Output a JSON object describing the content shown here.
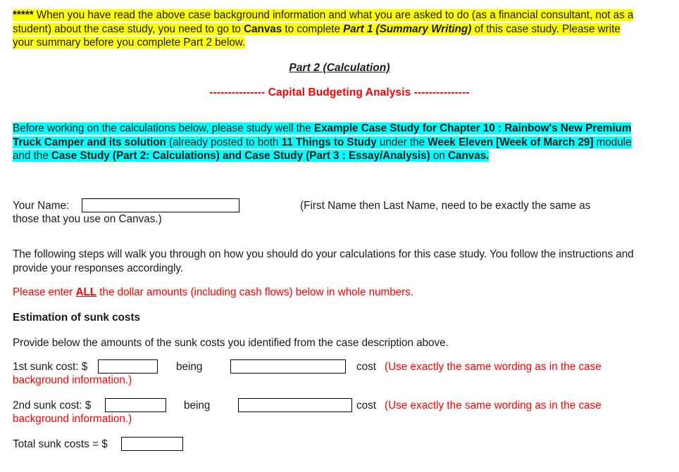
{
  "document": {
    "intro_note": {
      "stars": "***** ",
      "s1": "When you have read the above case background information and what you are asked to do (as a financial consultant, not as a student) about the case study, you need to go to ",
      "canvas": "Canvas",
      "s2": " to complete ",
      "part1": "Part 1 (Summary Writing)",
      "s3": " of this case study. Please write your summary before you complete Part 2 below.",
      "highlight_color": "#ffff00"
    },
    "part2_title": "Part 2 (Calculation)",
    "capital_heading": "--------------- Capital Budgeting Analysis ---------------",
    "capital_heading_color": "#ff0000",
    "study_note": {
      "s1": "Before working on the calculations below, please study well the ",
      "b1": "Example Case Study for Chapter 10 : Rainbow's New Premium Truck Camper and its solution",
      "s2": " (already posted to both ",
      "b2": "11 Things to Study",
      "s3": " under the ",
      "b3": "Week Eleven [Week of March 29]",
      "s4": " module and the ",
      "b4": "Case Study (Part 2: Calculations) and Case Study (Part 3 : Essay/Analysis)",
      "s5": " on ",
      "b5": "Canvas.",
      "highlight_color": "#00ffff"
    },
    "name_row": {
      "label": "Your Name:",
      "value": "",
      "placeholder": "",
      "hint_line1": "(First Name then Last Name, need to be exactly the same as",
      "hint_line2": "those that you use on Canvas.)"
    },
    "steps_para": "The following steps will walk you through on how you should do your calculations for this case study. You follow the instructions and provide your responses accordingly.",
    "whole_numbers_note": {
      "s1": "Please enter ",
      "all": "ALL",
      "s2": " the dollar amounts (including cash flows) below in whole numbers.",
      "color": "#ff0000"
    },
    "sunk_section": {
      "heading": "Estimation of sunk costs",
      "instruction": "Provide below the amounts of the sunk costs you identified from the case description above.",
      "rows": [
        {
          "label": "1st sunk cost: $",
          "amount_value": "",
          "being": "being",
          "description_value": "",
          "cost_label": "cost",
          "note_line1": "(Use exactly the same wording as in the case",
          "note_line2": "background information.)"
        },
        {
          "label": "2nd sunk cost: $",
          "amount_value": "",
          "being": "being",
          "description_value": "",
          "cost_label": "cost",
          "note_line1": "(Use exactly the same wording as in the case",
          "note_line2": "background information.)"
        }
      ],
      "total_label": "Total sunk costs = $",
      "total_value": ""
    }
  }
}
